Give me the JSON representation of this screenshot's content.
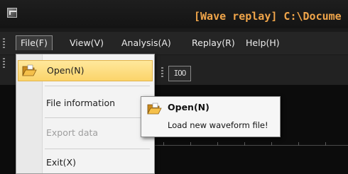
{
  "window": {
    "title": "[Wave replay] C:\\Docume"
  },
  "menubar": {
    "items": [
      {
        "label": "File(F)"
      },
      {
        "label": "View(V)"
      },
      {
        "label": "Analysis(A)"
      },
      {
        "label": "Replay(R)"
      },
      {
        "label": "Help(H)"
      }
    ]
  },
  "toolbar": {
    "button_label": "IOO"
  },
  "file_menu": {
    "items": [
      {
        "label": "Open(N)",
        "icon": "folder-open-icon",
        "highlighted": true
      },
      {
        "label": "File information"
      },
      {
        "label": "Export data",
        "disabled": true
      },
      {
        "label": "Exit(X)"
      }
    ]
  },
  "tooltip": {
    "title": "Open(N)",
    "description": "Load new waveform file!",
    "icon": "folder-open-icon"
  },
  "colors": {
    "title_text": "#f0a54a",
    "highlight": "#fbd46a",
    "background": "#1a1a1a"
  }
}
